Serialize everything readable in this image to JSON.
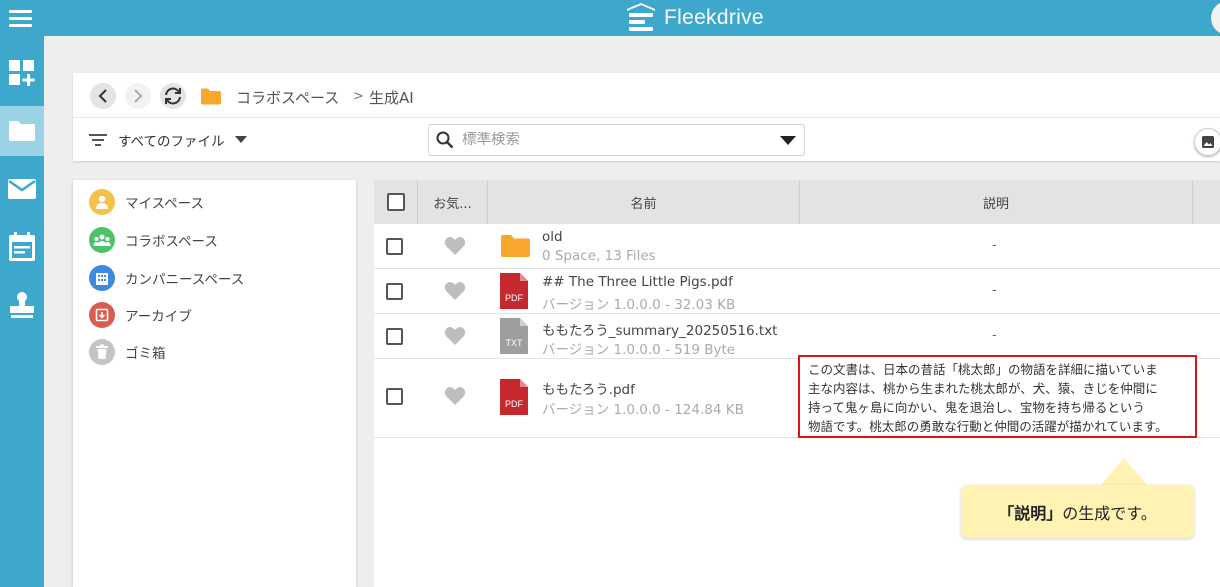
{
  "app": {
    "brand": "Fleekdrive"
  },
  "colors": {
    "topbar": "#3ea7cc",
    "highlight": "#d9141a",
    "callout": "#fff2b3",
    "folder": "#f7a72b",
    "pdf": "#c5282d",
    "txt": "#9e9e9e"
  },
  "breadcrumb": {
    "items": [
      "コラボスペース",
      "生成AI"
    ],
    "separator": ">"
  },
  "toolbar": {
    "filter_label": "すべてのファイル",
    "search_placeholder": "標準検索"
  },
  "sidebar": {
    "items": [
      {
        "label": "マイスペース",
        "icon": "person-icon"
      },
      {
        "label": "コラボスペース",
        "icon": "group-icon"
      },
      {
        "label": "カンパニースペース",
        "icon": "building-icon"
      },
      {
        "label": "アーカイブ",
        "icon": "archive-icon"
      },
      {
        "label": "ゴミ箱",
        "icon": "trash-icon"
      }
    ]
  },
  "table": {
    "headers": {
      "favorite": "お気...",
      "name": "名前",
      "description": "説明"
    },
    "rows": [
      {
        "name": "old",
        "meta": "0 Space, 13 Files",
        "type": "folder",
        "description": "-"
      },
      {
        "name": "## The Three Little Pigs.pdf",
        "meta": "バージョン 1.0.0.0 - 32.03 KB",
        "type": "pdf",
        "description": "-"
      },
      {
        "name": "ももたろう_summary_20250516.txt",
        "meta": "バージョン 1.0.0.0 - 519 Byte",
        "type": "txt",
        "description": "-"
      },
      {
        "name": "ももたろう.pdf",
        "meta": "バージョン 1.0.0.0 - 124.84 KB",
        "type": "pdf",
        "description_lines": [
          "この文書は、日本の昔話「桃太郎」の物語を詳細に描いていま",
          "主な内容は、桃から生まれた桃太郎が、犬、猿、きじを仲間に",
          "持って鬼ヶ島に向かい、鬼を退治し、宝物を持ち帰るという",
          "物語です。桃太郎の勇敢な行動と仲間の活躍が描かれています。"
        ]
      }
    ],
    "icon_labels": {
      "pdf": "PDF",
      "txt": "TXT"
    }
  },
  "callout": {
    "bold": "「説明」",
    "rest": "の生成です。"
  }
}
